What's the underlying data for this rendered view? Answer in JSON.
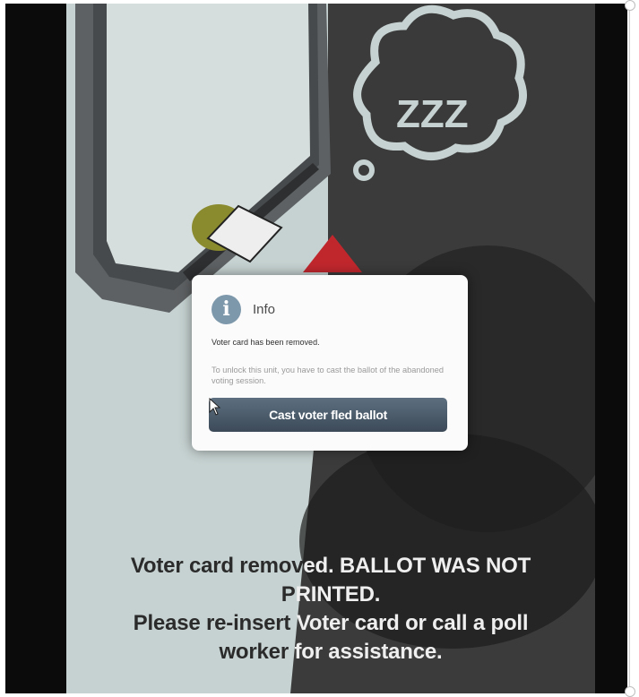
{
  "dialog": {
    "title": "Info",
    "message": "Voter card has been removed.",
    "subtext": "To unlock this unit, you have to cast the ballot of the abandoned voting session.",
    "button_label": "Cast voter fled ballot"
  },
  "screen_message": {
    "line1_a": "Voter card remov",
    "line1_b": "ed. BALLOT WAS NOT",
    "line2_a": "P",
    "line2_b": "RINTED.",
    "line3_a": "Please re-insert ",
    "line3_b": "Voter card or call a poll",
    "line4_a": "worker ",
    "line4_b": "for assistance."
  },
  "illustration": {
    "sleep_text": "ZZZ",
    "alert_icon": "warning-triangle-icon"
  },
  "colors": {
    "screen_left": "#c7d3d2",
    "screen_right": "#3a3a3a",
    "button": "#4a5a6a",
    "info_icon": "#7d97ab",
    "alert": "#c0272d"
  }
}
